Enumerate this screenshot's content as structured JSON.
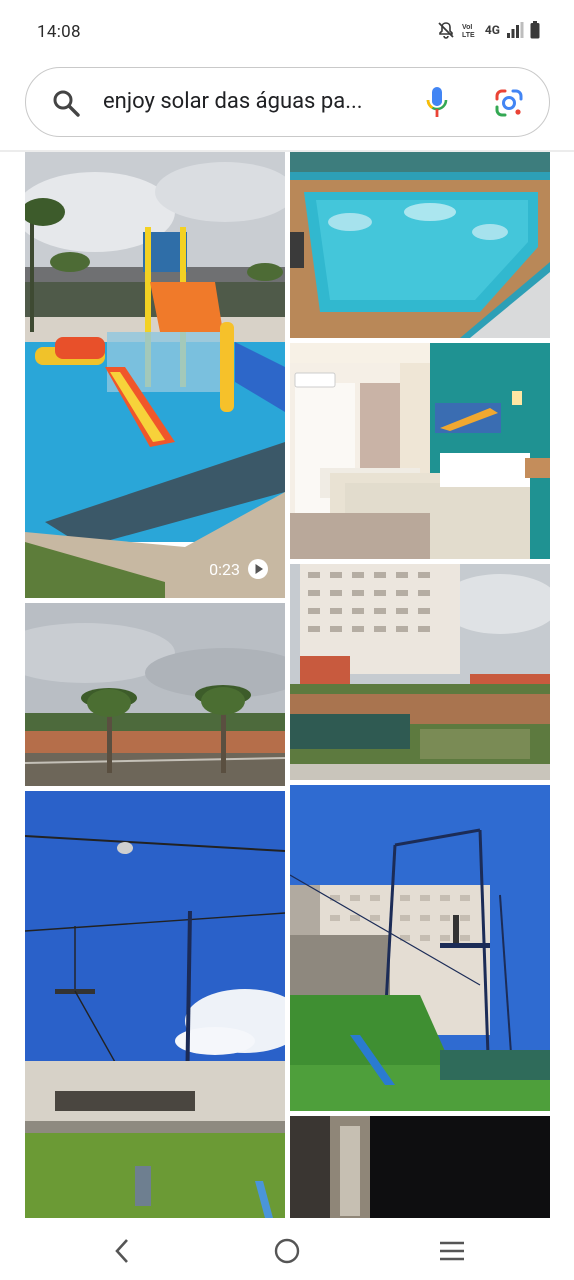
{
  "status": {
    "time": "14:08",
    "network": "4G",
    "icons": [
      "mute-icon",
      "vowifi-icon",
      "signal-icon",
      "battery-icon"
    ]
  },
  "search": {
    "query": "enjoy solar das águas pa...",
    "icons": [
      "search-icon",
      "mic-icon",
      "lens-icon"
    ]
  },
  "results": {
    "video_duration": "0:23"
  },
  "nav": {
    "icons": [
      "back-icon",
      "home-icon",
      "recents-icon"
    ]
  },
  "colors": {
    "google_blue": "#4285F4",
    "google_red": "#EA4335",
    "google_yellow": "#FBBC05",
    "google_green": "#34A853"
  }
}
